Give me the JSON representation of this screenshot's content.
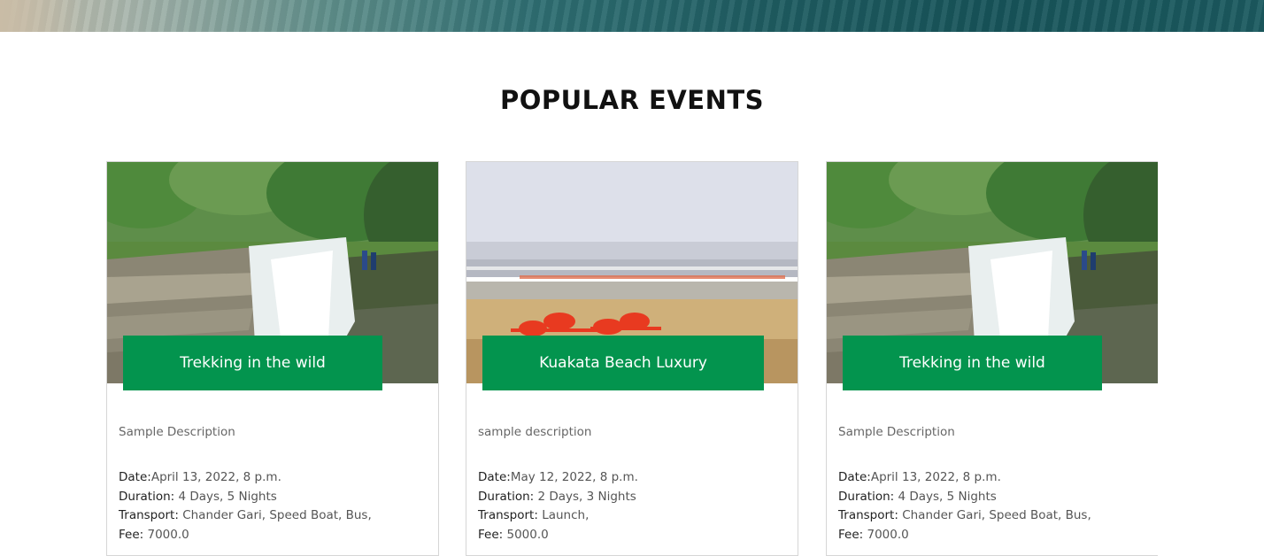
{
  "section": {
    "title": "POPULAR EVENTS"
  },
  "events": [
    {
      "title": "Trekking in the wild",
      "image": "waterfall-image",
      "description": "Sample Description",
      "date_label": "Date:",
      "date": "April 13, 2022, 8 p.m.",
      "duration_label": "Duration: ",
      "duration": "4 Days, 5 Nights",
      "transport_label": "Transport: ",
      "transport": "Chander Gari, Speed Boat, Bus,",
      "fee_label": "Fee: ",
      "fee": "7000.0"
    },
    {
      "title": "Kuakata Beach Luxury",
      "image": "beach-crabs-image",
      "description": "sample description",
      "date_label": "Date:",
      "date": "May 12, 2022, 8 p.m.",
      "duration_label": "Duration: ",
      "duration": "2 Days, 3 Nights",
      "transport_label": "Transport: ",
      "transport": "Launch,",
      "fee_label": "Fee: ",
      "fee": "5000.0"
    },
    {
      "title": "Trekking in the wild",
      "image": "waterfall-image",
      "description": "Sample Description",
      "date_label": "Date:",
      "date": "April 13, 2022, 8 p.m.",
      "duration_label": "Duration: ",
      "duration": "4 Days, 5 Nights",
      "transport_label": "Transport: ",
      "transport": "Chander Gari, Speed Boat, Bus,",
      "fee_label": "Fee: ",
      "fee": "7000.0"
    }
  ],
  "colors": {
    "accent": "#03944e",
    "title_text": "#111111"
  }
}
